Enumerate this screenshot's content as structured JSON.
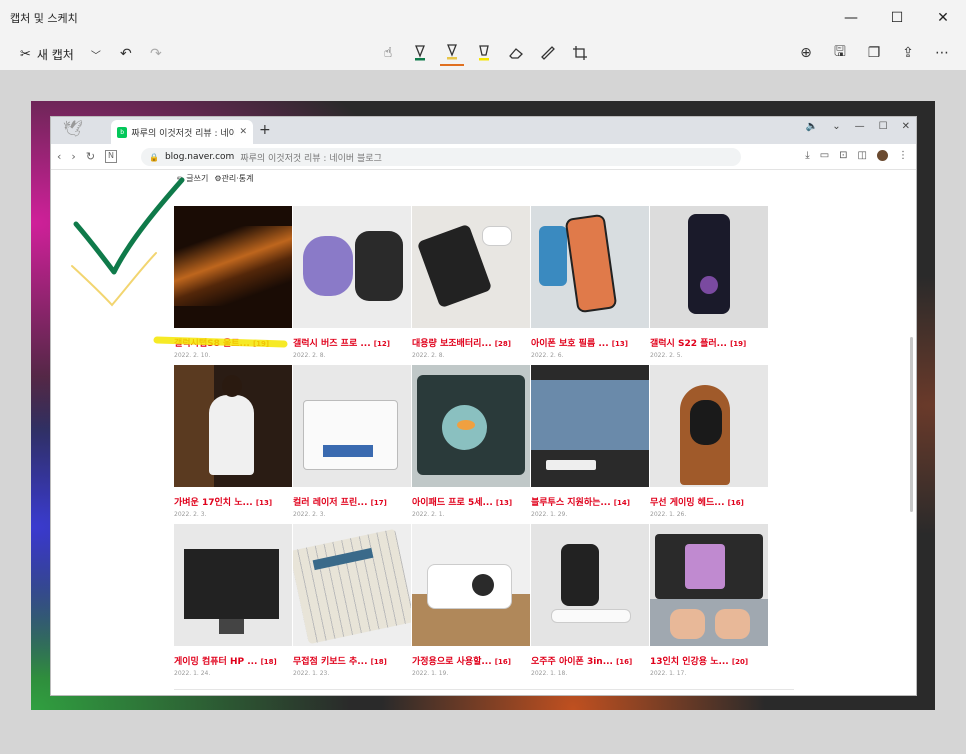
{
  "app": {
    "title": "캡처 및 스케치",
    "new_snip_label": "새 캡처"
  },
  "browser": {
    "tab_title": "짜루의 이것저것 리뷰 : 네이버",
    "url_host": "blog.naver.com",
    "url_path": "짜루의 이것저것 리뷰 : 네이버 블로그"
  },
  "blog": {
    "write_label": "글쓰기",
    "manage_label": "⚙관리·통계",
    "posts": [
      {
        "title": "갤럭시탭S8 울트...",
        "count": "[19]",
        "date": "2022. 2. 10."
      },
      {
        "title": "갤럭시 버즈 프로 ...",
        "count": "[12]",
        "date": "2022. 2. 8."
      },
      {
        "title": "대용량 보조배터리...",
        "count": "[28]",
        "date": "2022. 2. 8."
      },
      {
        "title": "아이폰 보호 필름 ...",
        "count": "[13]",
        "date": "2022. 2. 6."
      },
      {
        "title": "갤럭시 S22 플러...",
        "count": "[19]",
        "date": "2022. 2. 5."
      },
      {
        "title": "가벼운 17인치 노...",
        "count": "[13]",
        "date": "2022. 2. 3."
      },
      {
        "title": "컬러 레이저 프린...",
        "count": "[17]",
        "date": "2022. 2. 3."
      },
      {
        "title": "아이패드 프로 5세...",
        "count": "[13]",
        "date": "2022. 2. 1."
      },
      {
        "title": "블루투스 지원하는...",
        "count": "[14]",
        "date": "2022. 1. 29."
      },
      {
        "title": "무선 게이밍 헤드...",
        "count": "[16]",
        "date": "2022. 1. 26."
      },
      {
        "title": "게이밍 컴퓨터 HP ...",
        "count": "[18]",
        "date": "2022. 1. 24."
      },
      {
        "title": "무접점 키보드 추...",
        "count": "[18]",
        "date": "2022. 1. 23."
      },
      {
        "title": "가정용으로 사용할...",
        "count": "[16]",
        "date": "2022. 1. 19."
      },
      {
        "title": "오주주 아이폰 3in...",
        "count": "[16]",
        "date": "2022. 1. 18."
      },
      {
        "title": "13인치 인강용 노...",
        "count": "[20]",
        "date": "2022. 1. 17."
      }
    ]
  },
  "colors": {
    "accent": "#e07020",
    "post_title": "#e0001b",
    "ink_green": "#0f7a4a",
    "ink_yellow": "#f2d570",
    "highlighter": "#f5e600"
  }
}
